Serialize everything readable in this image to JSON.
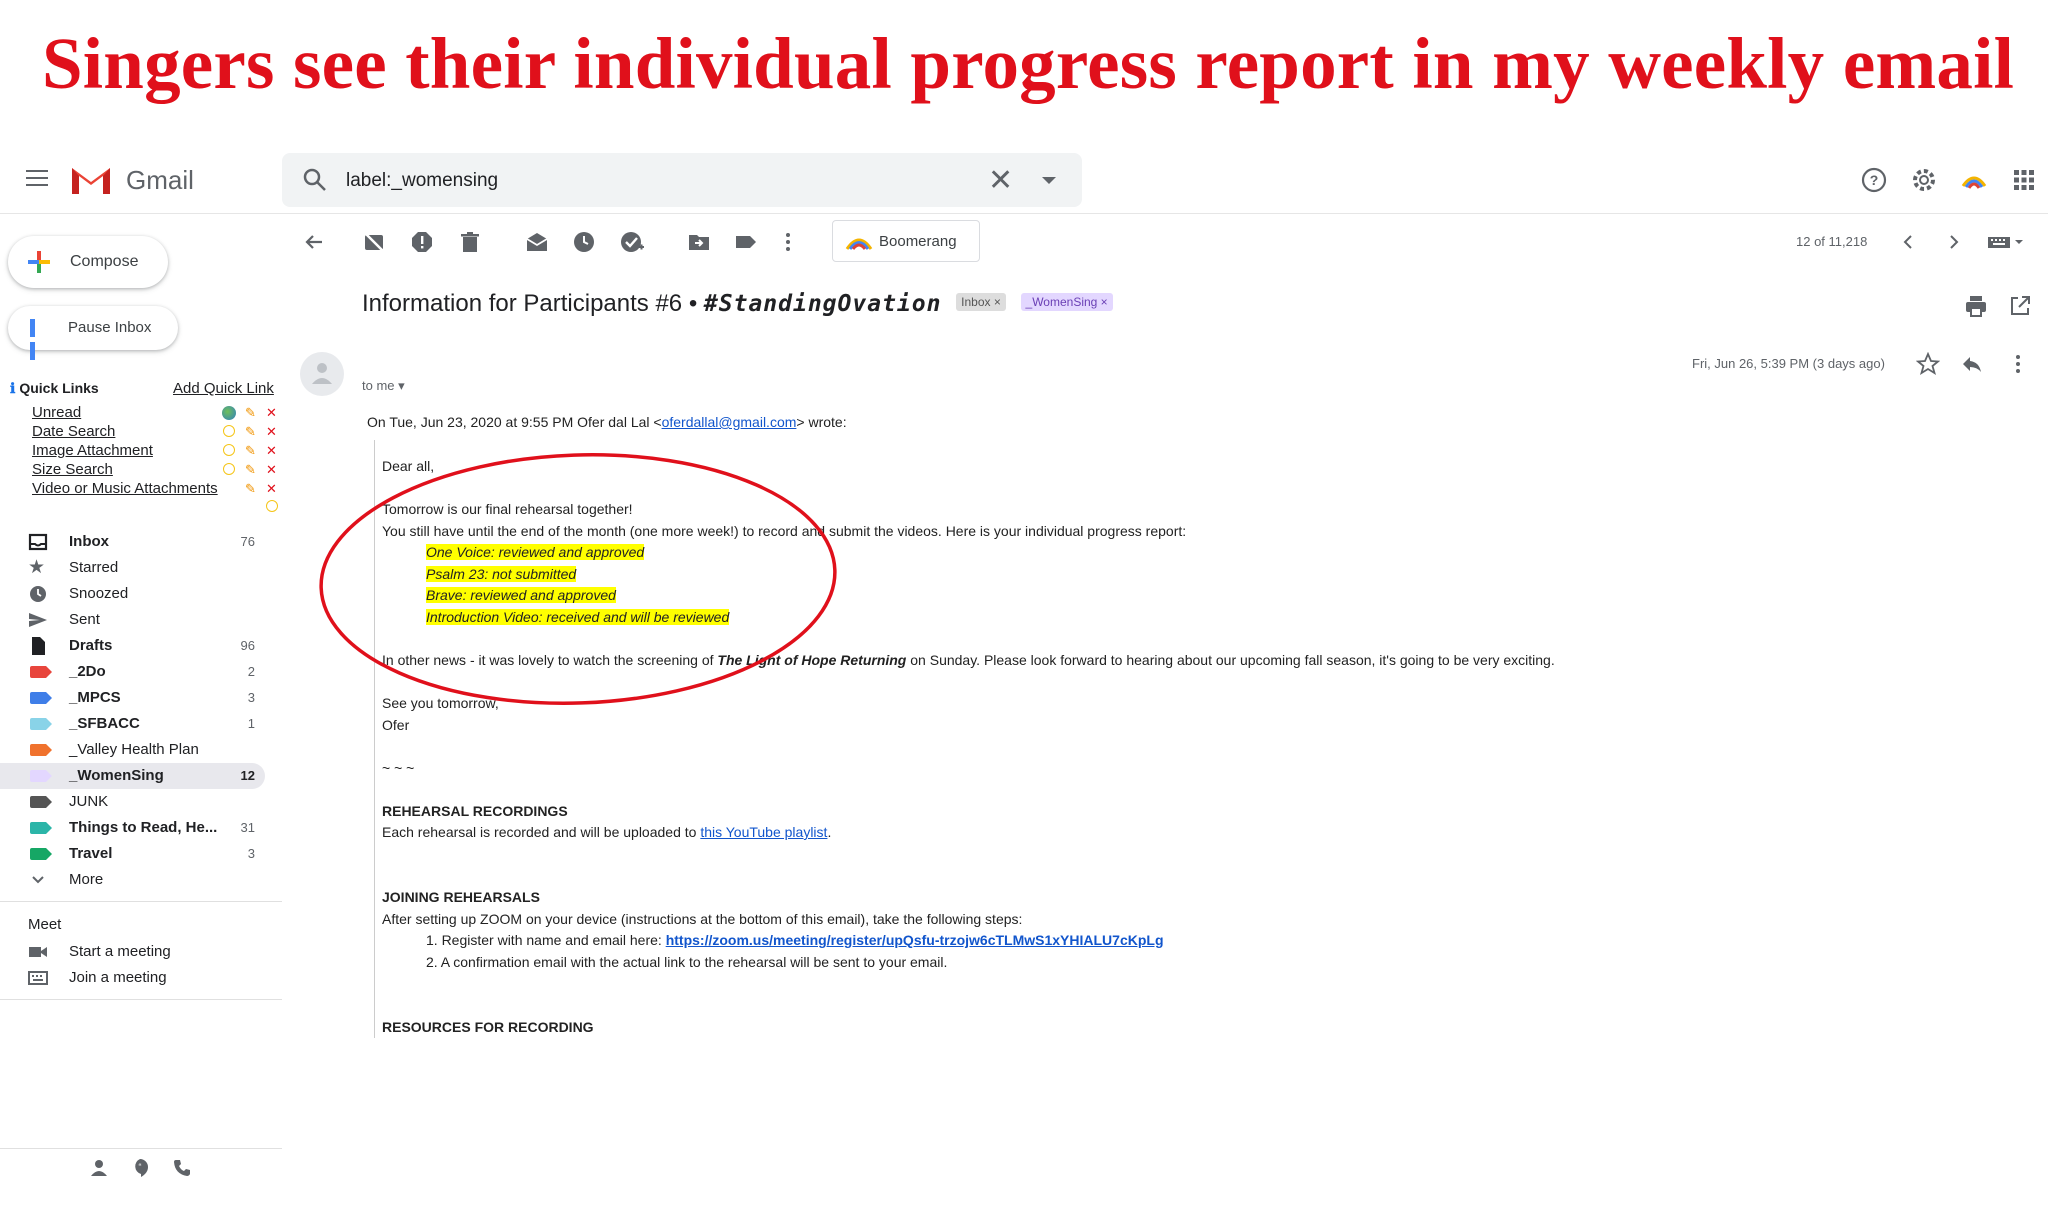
{
  "banner": {
    "title": "Singers see their individual progress report in my weekly email"
  },
  "header": {
    "app_name": "Gmail",
    "search_value": "label:_womensing"
  },
  "compose": {
    "label": "Compose"
  },
  "pause": {
    "label": "Pause Inbox"
  },
  "quick_links": {
    "title": "Quick Links",
    "add_label": "Add Quick Link",
    "items": [
      "Unread",
      "Date Search",
      "Image Attachment",
      "Size Search",
      "Video or Music Attachments"
    ]
  },
  "nav": [
    {
      "name": "Inbox",
      "count": "76",
      "bold": true
    },
    {
      "name": "Starred",
      "count": ""
    },
    {
      "name": "Snoozed",
      "count": ""
    },
    {
      "name": "Sent",
      "count": ""
    },
    {
      "name": "Drafts",
      "count": "96",
      "bold": true
    },
    {
      "name": "_2Do",
      "count": "2",
      "bold": true,
      "color": "#e8453c"
    },
    {
      "name": "_MPCS",
      "count": "3",
      "bold": true,
      "color": "#3f7ee8"
    },
    {
      "name": "_SFBACC",
      "count": "1",
      "bold": true,
      "color": "#89d3e8"
    },
    {
      "name": "_Valley Health Plan",
      "count": "",
      "color": "#f0722d"
    },
    {
      "name": "_WomenSing",
      "count": "12",
      "bold": true,
      "color": "#e3d7ff",
      "active": true
    },
    {
      "name": "JUNK",
      "count": "",
      "color": "#555555"
    },
    {
      "name": "Things to Read, He...",
      "count": "31",
      "bold": true,
      "color": "#2bb5a8"
    },
    {
      "name": "Travel",
      "count": "3",
      "bold": true,
      "color": "#16a765"
    },
    {
      "name": "More",
      "count": ""
    }
  ],
  "meet": {
    "title": "Meet",
    "start": "Start a meeting",
    "join": "Join a meeting"
  },
  "toolbar": {
    "boomerang": "Boomerang",
    "pager": "12 of 11,218"
  },
  "email": {
    "subject_prefix": "Information for Participants #6 • ",
    "subject_hashtag": "#StandingOvation",
    "chip_inbox": "Inbox ×",
    "chip_label": "_WomenSing ×",
    "to_me": "to me ▾",
    "date": "Fri, Jun 26, 5:39 PM (3 days ago)",
    "wrote_prefix": "On Tue, Jun 23, 2020 at 9:55 PM Ofer dal Lal <",
    "wrote_email": "oferdallal@gmail.com",
    "wrote_suffix": "> wrote:",
    "greeting": "Dear all,",
    "line1": "Tomorrow is our final rehearsal together!",
    "line2": "You still have until the end of the month (one more week!) to record and submit the videos. Here is your individual progress report:",
    "progress": [
      "One Voice: reviewed and approved",
      "Psalm 23: not submitted",
      "Brave: reviewed and approved",
      "Introduction Video: received and will be reviewed"
    ],
    "news_prefix": "In other news - it was lovely to watch the screening of ",
    "news_title": "The Light of Hope Returning",
    "news_suffix": " on Sunday. Please look forward to hearing about our upcoming fall season, it's going to be very exciting.",
    "signoff1": "See you tomorrow,",
    "signoff2": "Ofer",
    "tilde": "~ ~ ~",
    "rec_head": "REHEARSAL RECORDINGS",
    "rec_text": "Each rehearsal is recorded and will be uploaded to ",
    "rec_link": "this YouTube playlist",
    "rec_end": ".",
    "join_head": "JOINING REHEARSALS",
    "join_text": "After setting up ZOOM on your device (instructions at the bottom of this email), take the following steps:",
    "step1_prefix": "1. Register with name and email here: ",
    "step1_link": "https://zoom.us/meeting/register/upQsfu-trzojw6cTLMwS1xYHIALU7cKpLg",
    "step2": "2. A confirmation email with the actual link to the rehearsal will be sent to your email.",
    "res_head": "RESOURCES FOR RECORDING"
  },
  "colors": {
    "annotation": "#e0101b",
    "highlight": "#ffff00",
    "link": "#1155cc"
  }
}
